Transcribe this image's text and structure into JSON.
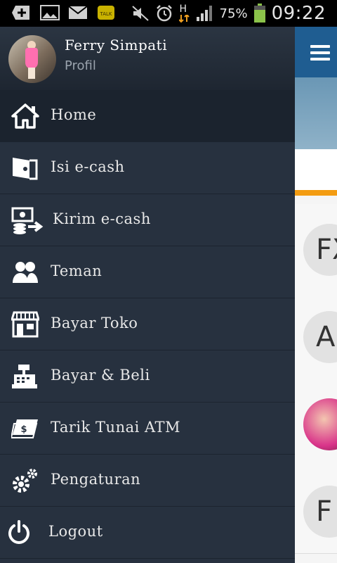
{
  "status_bar": {
    "battery_percent": "75%",
    "time": "09:22",
    "network": "H",
    "icons": [
      "add-icon",
      "image-icon",
      "mail-icon",
      "kakaotalk-icon",
      "mute-icon",
      "alarm-icon",
      "network-h-icon",
      "signal-icon",
      "battery-icon"
    ]
  },
  "profile": {
    "name": "Ferry Simpati",
    "subtitle": "Profil"
  },
  "menu": {
    "items": [
      {
        "label": "Home",
        "icon": "home-icon",
        "active": true
      },
      {
        "label": "Isi e-cash",
        "icon": "wallet-icon"
      },
      {
        "label": "Kirim e-cash",
        "icon": "send-money-icon"
      },
      {
        "label": "Teman",
        "icon": "friends-icon"
      },
      {
        "label": "Bayar Toko",
        "icon": "store-icon"
      },
      {
        "label": "Bayar & Beli",
        "icon": "cash-register-icon"
      },
      {
        "label": "Tarik Tunai ATM",
        "icon": "atm-card-icon"
      },
      {
        "label": "Pengaturan",
        "icon": "settings-icon"
      },
      {
        "label": "Logout",
        "icon": "power-icon"
      }
    ]
  },
  "background_list": {
    "avatar_initials": [
      "FX",
      "A",
      "",
      "F"
    ]
  },
  "colors": {
    "drawer_bg": "#27313f",
    "header_blue": "#1f5d91",
    "accent_orange": "#f39c12"
  }
}
